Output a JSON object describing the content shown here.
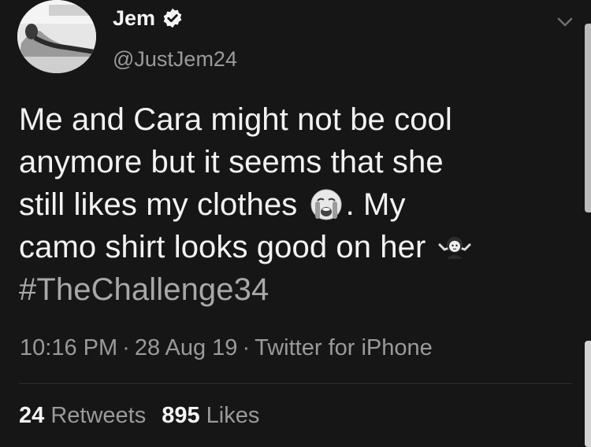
{
  "tweet": {
    "author": {
      "name": "Jem",
      "handle": "@JustJem24",
      "verified": true
    },
    "text_lines": {
      "line1": "Me and Cara might not be cool",
      "line2": "anymore but it seems that she",
      "line3_before_emoji": "still likes my clothes",
      "line3_after_emoji": ". My",
      "line4": "camo shirt looks good on her"
    },
    "hashtag": "#TheChallenge34",
    "emojis": [
      "crying-face-icon",
      "shrugging-person-icon"
    ],
    "meta": {
      "time": "10:16 PM",
      "date": "28 Aug 19",
      "source": "Twitter for iPhone",
      "separator": "·"
    },
    "stats": {
      "retweets_count": "24",
      "retweets_label": "Retweets",
      "likes_count": "895",
      "likes_label": "Likes"
    }
  },
  "colors": {
    "background": "#161616",
    "primary_text": "#f3f3f3",
    "secondary_text": "#9a9a9a"
  }
}
